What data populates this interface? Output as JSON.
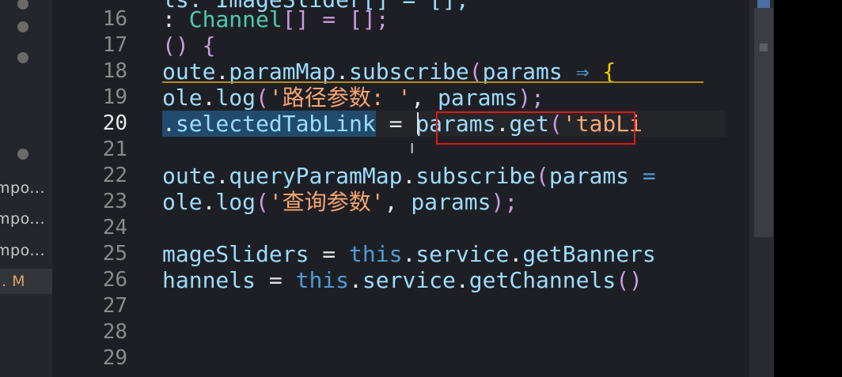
{
  "sidebar": {
    "items": [
      {
        "label": "mpo..."
      },
      {
        "label": "mpo..."
      },
      {
        "label": "mpo..."
      },
      {
        "label": ". M"
      }
    ]
  },
  "gutter": {
    "line_numbers": [
      "16",
      "17",
      "18",
      "19",
      "20",
      "21",
      "22",
      "23",
      "24",
      "25",
      "26",
      "27",
      "28",
      "29"
    ],
    "active_line": "20"
  },
  "code": {
    "line_top": "ls: ImageSlider[] = [];",
    "line16_a": ": ",
    "line16_b": "Channel",
    "line16_c": "[] = [];",
    "line17_a": "() {",
    "line18_a": "oute",
    "line18_b": ".",
    "line18_c": "paramMap",
    "line18_d": ".",
    "line18_e": "subscribe",
    "line18_f": "(",
    "line18_g": "params",
    "line18_h": " ⇒ ",
    "line18_i": "{",
    "line19_a": "ole",
    "line19_b": ".",
    "line19_c": "log",
    "line19_d": "(",
    "line19_e": "'路径参数: '",
    "line19_f": ", ",
    "line19_g": "params",
    "line19_h": ");",
    "line20_a": ".",
    "line20_b": "selectedTabLink",
    "line20_c": " = ",
    "line20_d": "params",
    "line20_e": ".",
    "line20_f": "get",
    "line20_g": "(",
    "line20_h": "'tabLi",
    "line22_a": "oute",
    "line22_b": ".",
    "line22_c": "queryParamMap",
    "line22_d": ".",
    "line22_e": "subscribe",
    "line22_f": "(",
    "line22_g": "params",
    "line22_h": " =",
    "line23_a": "ole",
    "line23_b": ".",
    "line23_c": "log",
    "line23_d": "(",
    "line23_e": "'查询参数'",
    "line23_f": ", ",
    "line23_g": "params",
    "line23_h": ");",
    "line25_a": "mageSliders",
    "line25_b": " = ",
    "line25_c": "this",
    "line25_d": ".",
    "line25_e": "service",
    "line25_f": ".",
    "line25_g": "getBanners",
    "line26_a": "hannels",
    "line26_b": " = ",
    "line26_c": "this",
    "line26_d": ".",
    "line26_e": "service",
    "line26_f": ".",
    "line26_g": "getChannels",
    "line26_h": "()"
  },
  "colors": {
    "background": "#1e1f24",
    "sidebar_bg": "#25262b",
    "variable": "#9cdcfe",
    "string": "#f4a672",
    "keyword": "#4e9bd6",
    "bracket": "#c89be3",
    "annotation_box": "#e01818",
    "modified": "#d8a267"
  }
}
